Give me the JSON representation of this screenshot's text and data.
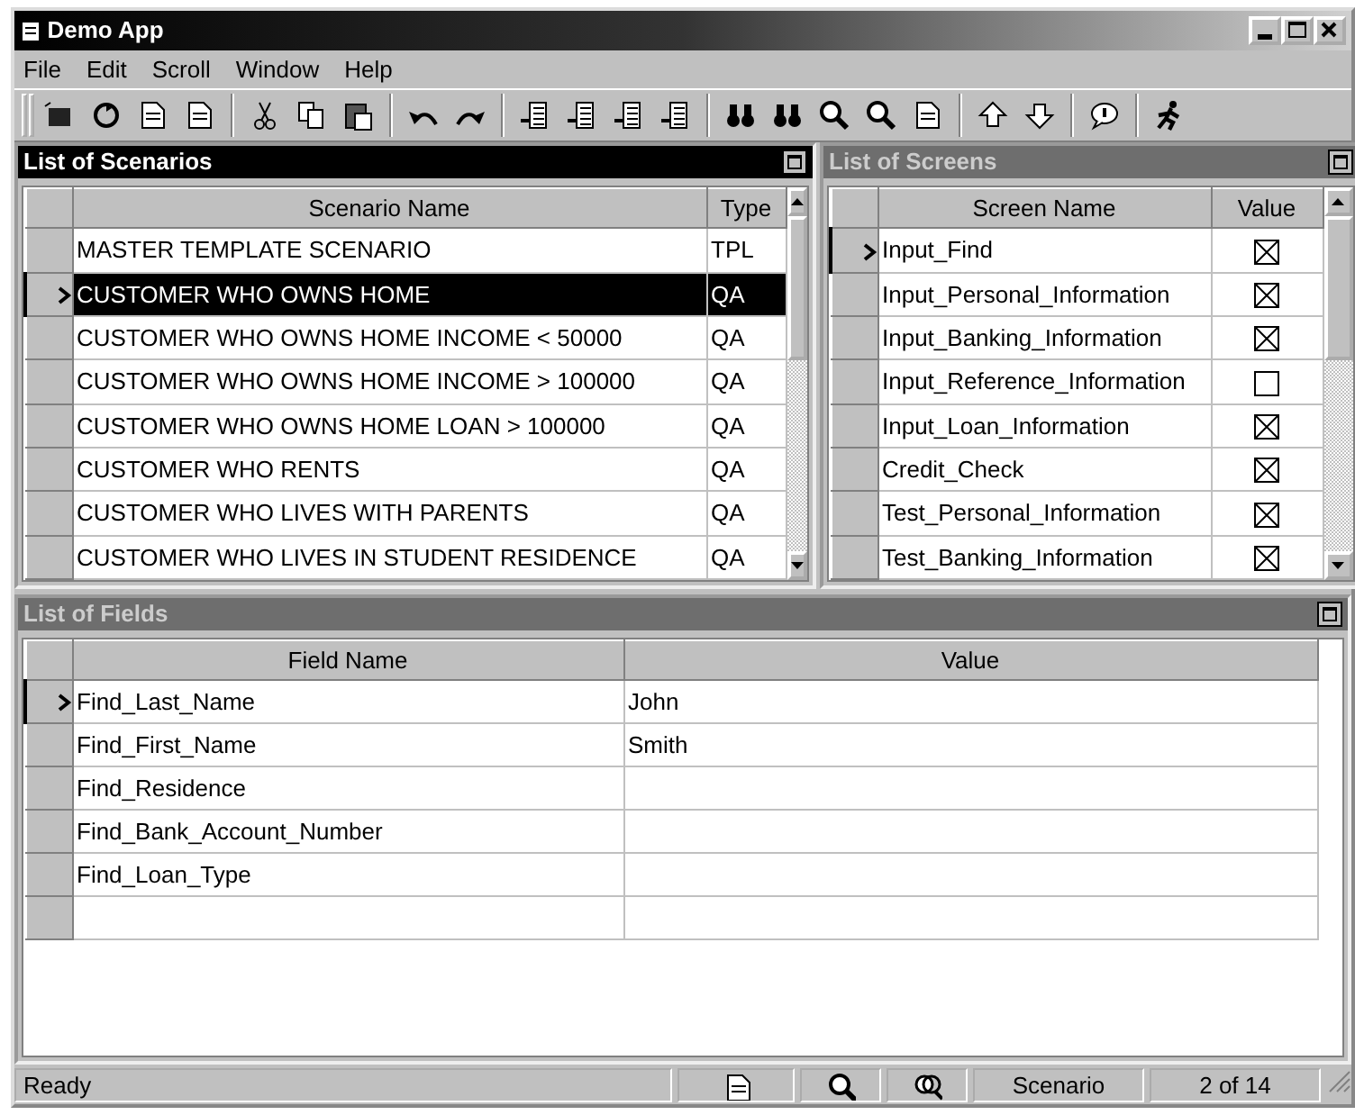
{
  "window": {
    "title": "Demo App"
  },
  "menu": [
    "File",
    "Edit",
    "Scroll",
    "Window",
    "Help"
  ],
  "scenarios": {
    "title": "List of Scenarios",
    "active": true,
    "columns": [
      "Scenario Name",
      "Type"
    ],
    "rows": [
      {
        "name": "MASTER TEMPLATE SCENARIO",
        "type": "TPL",
        "selected": false
      },
      {
        "name": "CUSTOMER WHO OWNS HOME",
        "type": "QA",
        "selected": true
      },
      {
        "name": "CUSTOMER WHO OWNS HOME INCOME < 50000",
        "type": "QA",
        "selected": false
      },
      {
        "name": "CUSTOMER WHO OWNS HOME INCOME > 100000",
        "type": "QA",
        "selected": false
      },
      {
        "name": "CUSTOMER WHO OWNS HOME LOAN > 100000",
        "type": "QA",
        "selected": false
      },
      {
        "name": "CUSTOMER WHO RENTS",
        "type": "QA",
        "selected": false
      },
      {
        "name": "CUSTOMER WHO LIVES WITH PARENTS",
        "type": "QA",
        "selected": false
      },
      {
        "name": "CUSTOMER WHO LIVES IN STUDENT RESIDENCE",
        "type": "QA",
        "selected": false
      }
    ]
  },
  "screens": {
    "title": "List of Screens",
    "active": false,
    "columns": [
      "Screen Name",
      "Value"
    ],
    "rows": [
      {
        "name": "Input_Find",
        "checked": true,
        "selected": true
      },
      {
        "name": "Input_Personal_Information",
        "checked": true,
        "selected": false
      },
      {
        "name": "Input_Banking_Information",
        "checked": true,
        "selected": false
      },
      {
        "name": "Input_Reference_Information",
        "checked": false,
        "selected": false
      },
      {
        "name": "Input_Loan_Information",
        "checked": true,
        "selected": false
      },
      {
        "name": "Credit_Check",
        "checked": true,
        "selected": false
      },
      {
        "name": "Test_Personal_Information",
        "checked": true,
        "selected": false
      },
      {
        "name": "Test_Banking_Information",
        "checked": true,
        "selected": false
      }
    ]
  },
  "fields": {
    "title": "List of Fields",
    "active": false,
    "columns": [
      "Field Name",
      "Value"
    ],
    "rows": [
      {
        "name": "Find_Last_Name",
        "value": "John",
        "selected": true
      },
      {
        "name": "Find_First_Name",
        "value": "Smith",
        "selected": false
      },
      {
        "name": "Find_Residence",
        "selected": false
      },
      {
        "name": "Find_Bank_Account_Number",
        "selected": false
      },
      {
        "name": "Find_Loan_Type",
        "selected": false
      }
    ]
  },
  "status_bar": {
    "message": "Ready",
    "mode": "Scenario",
    "position": "2 of 14"
  }
}
